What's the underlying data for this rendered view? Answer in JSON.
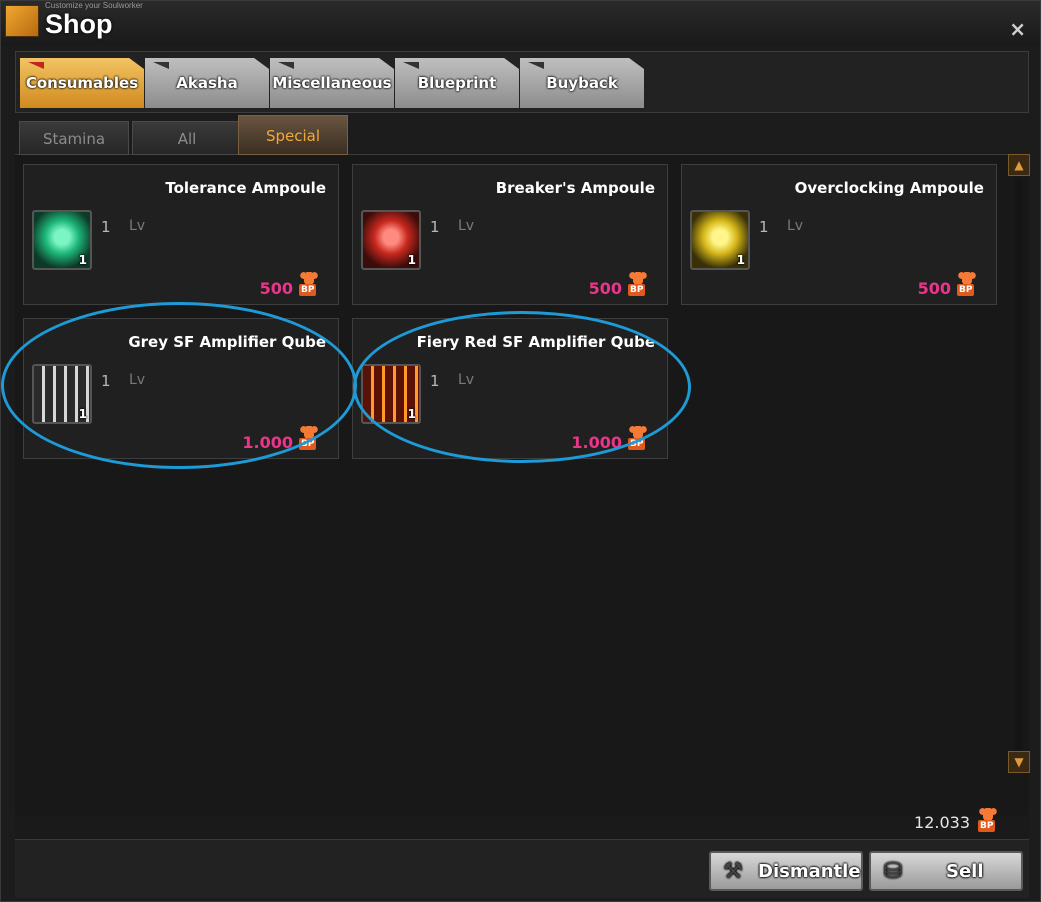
{
  "window": {
    "subtitle": "Customize your Soulworker",
    "title": "Shop",
    "close_label": "×"
  },
  "main_tabs": [
    {
      "label": "Consumables",
      "active": true
    },
    {
      "label": "Akasha",
      "active": false
    },
    {
      "label": "Miscellaneous",
      "active": false
    },
    {
      "label": "Blueprint",
      "active": false
    },
    {
      "label": "Buyback",
      "active": false
    }
  ],
  "sub_tabs": [
    {
      "label": "Stamina",
      "active": false
    },
    {
      "label": "All",
      "active": false
    },
    {
      "label": "Special",
      "active": true
    }
  ],
  "items": [
    {
      "name": "Tolerance Ampoule",
      "qty": "1",
      "level": "1",
      "level_label": "Lv",
      "price": "500",
      "currency": "BP",
      "icon": "green-ampoule-icon",
      "color": "#1fb77a"
    },
    {
      "name": "Breaker's Ampoule",
      "qty": "1",
      "level": "1",
      "level_label": "Lv",
      "price": "500",
      "currency": "BP",
      "icon": "red-ampoule-icon",
      "color": "#c8281e"
    },
    {
      "name": "Overclocking Ampoule",
      "qty": "1",
      "level": "1",
      "level_label": "Lv",
      "price": "500",
      "currency": "BP",
      "icon": "yellow-ampoule-icon",
      "color": "#d6b81a"
    },
    {
      "name": "Grey SF Amplifier Qube",
      "qty": "1",
      "level": "1",
      "level_label": "Lv",
      "price": "1.000",
      "currency": "BP",
      "icon": "grey-qube-icon",
      "color": "#8a8a8a",
      "highlighted": true
    },
    {
      "name": "Fiery Red SF Amplifier Qube",
      "qty": "1",
      "level": "1",
      "level_label": "Lv",
      "price": "1.000",
      "currency": "BP",
      "icon": "fiery-red-qube-icon",
      "color": "#d84a14",
      "highlighted": true
    }
  ],
  "scroll": {
    "up": "▲",
    "down": "▼"
  },
  "wallet": {
    "amount": "12.033",
    "currency": "BP"
  },
  "buttons": {
    "dismantle": "Dismantle",
    "sell": "Sell"
  },
  "colors": {
    "accent": "#f3a83b",
    "price": "#e9358a",
    "highlight": "#1e9ad6",
    "bp": "#f47a35"
  }
}
